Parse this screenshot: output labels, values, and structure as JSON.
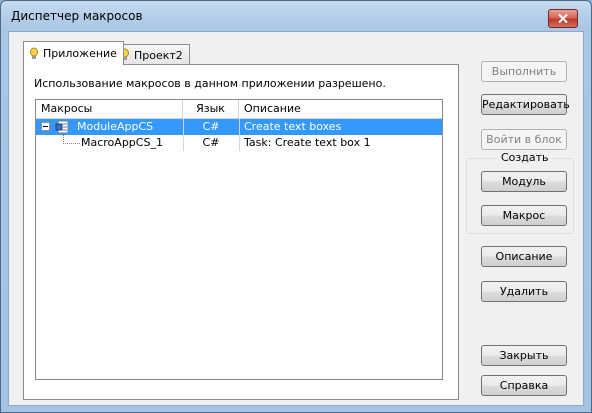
{
  "window": {
    "title": "Диспетчер макросов"
  },
  "tabs": [
    {
      "label": "Приложение",
      "icon": "bulb-icon",
      "active": true
    },
    {
      "label": "Проект2",
      "icon": "bulb-icon",
      "active": false
    }
  ],
  "info_text": "Использование макросов в данном приложении разрешено.",
  "list": {
    "columns": [
      "Макросы",
      "Язык",
      "Описание"
    ],
    "rows": [
      {
        "name": "ModuleAppCS",
        "lang": "C#",
        "desc": "Create text boxes",
        "selected": true,
        "expanded": true,
        "icon": "module-icon"
      },
      {
        "name": "MacroAppCS_1",
        "lang": "C#",
        "desc": "Task: Create text box 1",
        "selected": false
      }
    ]
  },
  "buttons": {
    "run": "Выполнить",
    "edit": "Редактировать",
    "step_into": "Войти в блок",
    "create_group": "Создать",
    "module": "Модуль",
    "macro": "Макрос",
    "description": "Описание",
    "delete": "Удалить",
    "close": "Закрыть",
    "help": "Справка"
  },
  "colors": {
    "selection": "#3399ff",
    "titlebar": "#b6cfe9",
    "close_button": "#c0392b"
  }
}
